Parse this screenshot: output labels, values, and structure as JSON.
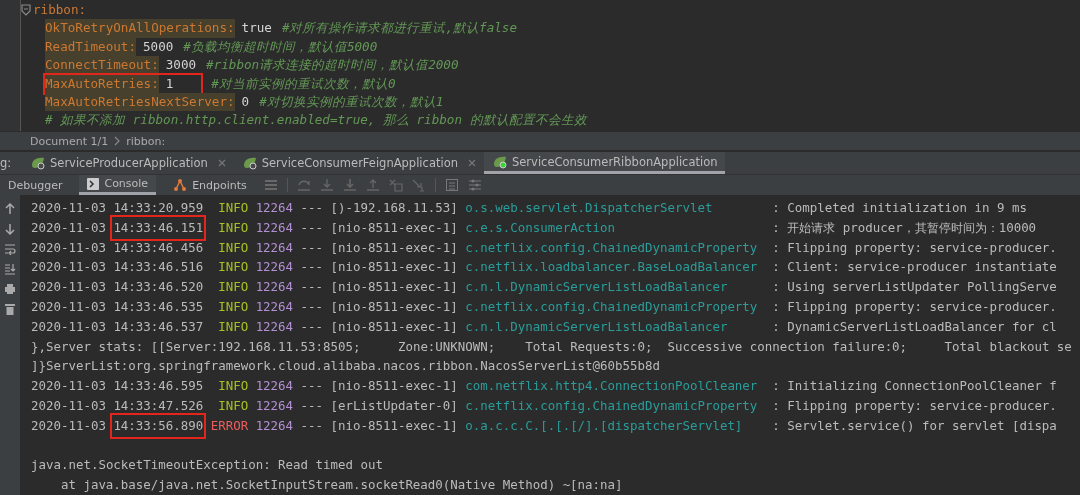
{
  "editor": {
    "section": "ribbon:",
    "lines": [
      {
        "key": "OkToRetryOnAllOperations:",
        "value": "true",
        "comment": "#对所有操作请求都进行重试,默认false",
        "highlighted": false
      },
      {
        "key": "ReadTimeout:",
        "value": "5000",
        "comment": "#负载均衡超时时间，默认值5000",
        "highlighted": false
      },
      {
        "key": "ConnectTimeout:",
        "value": "3000",
        "comment": "#ribbon请求连接的超时时间，默认值2000",
        "highlighted": false
      },
      {
        "key": "MaxAutoRetries:",
        "value": "1",
        "comment": "#对当前实例的重试次数，默认0",
        "highlighted": true
      },
      {
        "key": "MaxAutoRetriesNextServer:",
        "value": "0",
        "comment": "#对切换实例的重试次数，默认1",
        "highlighted": false
      }
    ],
    "trailing_comment": "# 如果不添加 ribbon.http.client.enabled=true, 那么 ribbon 的默认配置不会生效"
  },
  "breadcrumb": [
    "Document 1/1",
    "ribbon:"
  ],
  "run_tabs": {
    "label": "g:",
    "tabs": [
      {
        "label": "ServiceProducerApplication",
        "selected": false
      },
      {
        "label": "ServiceConsumerFeignApplication",
        "selected": false
      },
      {
        "label": "ServiceConsumerRibbonApplication",
        "selected": true
      }
    ]
  },
  "tool_tabs": [
    {
      "label": "Debugger",
      "selected": false
    },
    {
      "label": "Console",
      "selected": true
    },
    {
      "label": "Endpoints",
      "selected": false
    }
  ],
  "console": [
    {
      "kind": "log",
      "date": "2020-11-03",
      "time": "14:33:20.959",
      "highlighted": false,
      "level": "INFO",
      "pid": "12264",
      "dashes": "---",
      "thread": "[)-192.168.11.53]",
      "logger": "o.s.web.servlet.DispatcherServlet",
      "message": ": Completed initialization in 9 ms"
    },
    {
      "kind": "log",
      "date": "2020-11-03",
      "time": "14:33:46.151",
      "highlighted": true,
      "level": "INFO",
      "pid": "12264",
      "dashes": "---",
      "thread": "[nio-8511-exec-1]",
      "logger": "c.e.s.ConsumerAction",
      "message": ": 开始请求 producer，其暂停时间为：10000"
    },
    {
      "kind": "log",
      "date": "2020-11-03",
      "time": "14:33:46.456",
      "highlighted": false,
      "level": "INFO",
      "pid": "12264",
      "dashes": "---",
      "thread": "[nio-8511-exec-1]",
      "logger": "c.netflix.config.ChainedDynamicProperty",
      "message": ": Flipping property: service-producer."
    },
    {
      "kind": "log",
      "date": "2020-11-03",
      "time": "14:33:46.516",
      "highlighted": false,
      "level": "INFO",
      "pid": "12264",
      "dashes": "---",
      "thread": "[nio-8511-exec-1]",
      "logger": "c.netflix.loadbalancer.BaseLoadBalancer",
      "message": ": Client: service-producer instantiate"
    },
    {
      "kind": "log",
      "date": "2020-11-03",
      "time": "14:33:46.520",
      "highlighted": false,
      "level": "INFO",
      "pid": "12264",
      "dashes": "---",
      "thread": "[nio-8511-exec-1]",
      "logger": "c.n.l.DynamicServerListLoadBalancer",
      "message": ": Using serverListUpdater PollingServe"
    },
    {
      "kind": "log",
      "date": "2020-11-03",
      "time": "14:33:46.535",
      "highlighted": false,
      "level": "INFO",
      "pid": "12264",
      "dashes": "---",
      "thread": "[nio-8511-exec-1]",
      "logger": "c.netflix.config.ChainedDynamicProperty",
      "message": ": Flipping property: service-producer."
    },
    {
      "kind": "log",
      "date": "2020-11-03",
      "time": "14:33:46.537",
      "highlighted": false,
      "level": "INFO",
      "pid": "12264",
      "dashes": "---",
      "thread": "[nio-8511-exec-1]",
      "logger": "c.n.l.DynamicServerListLoadBalancer",
      "message": ": DynamicServerListLoadBalancer for cl"
    },
    {
      "kind": "text",
      "text": "},Server stats: [[Server:192.168.11.53:8505;     Zone:UNKNOWN;    Total Requests:0;  Successive connection failure:0;     Total blackout se"
    },
    {
      "kind": "text",
      "text": "]}ServerList:org.springframework.cloud.alibaba.nacos.ribbon.NacosServerList@60b55b8d"
    },
    {
      "kind": "log",
      "date": "2020-11-03",
      "time": "14:33:46.595",
      "highlighted": false,
      "level": "INFO",
      "pid": "12264",
      "dashes": "---",
      "thread": "[nio-8511-exec-1]",
      "logger": "com.netflix.http4.ConnectionPoolCleaner",
      "message": ": Initializing ConnectionPoolCleaner f"
    },
    {
      "kind": "log",
      "date": "2020-11-03",
      "time": "14:33:47.526",
      "highlighted": false,
      "level": "INFO",
      "pid": "12264",
      "dashes": "---",
      "thread": "[erListUpdater-0]",
      "logger": "c.netflix.config.ChainedDynamicProperty",
      "message": ": Flipping property: service-producer."
    },
    {
      "kind": "log",
      "date": "2020-11-03",
      "time": "14:33:56.890",
      "highlighted": true,
      "level": "ERROR",
      "pid": "12264",
      "dashes": "---",
      "thread": "[nio-8511-exec-1]",
      "logger": "o.a.c.c.C.[.[.[/].[dispatcherServlet]",
      "message": ": Servlet.service() for servlet [dispa"
    },
    {
      "kind": "blank"
    },
    {
      "kind": "text",
      "text": "java.net.SocketTimeoutException: Read timed out"
    },
    {
      "kind": "stack",
      "text": "at java.base/java.net.SocketInputStream.socketRead0(Native Method) ~[na:na]"
    }
  ]
}
